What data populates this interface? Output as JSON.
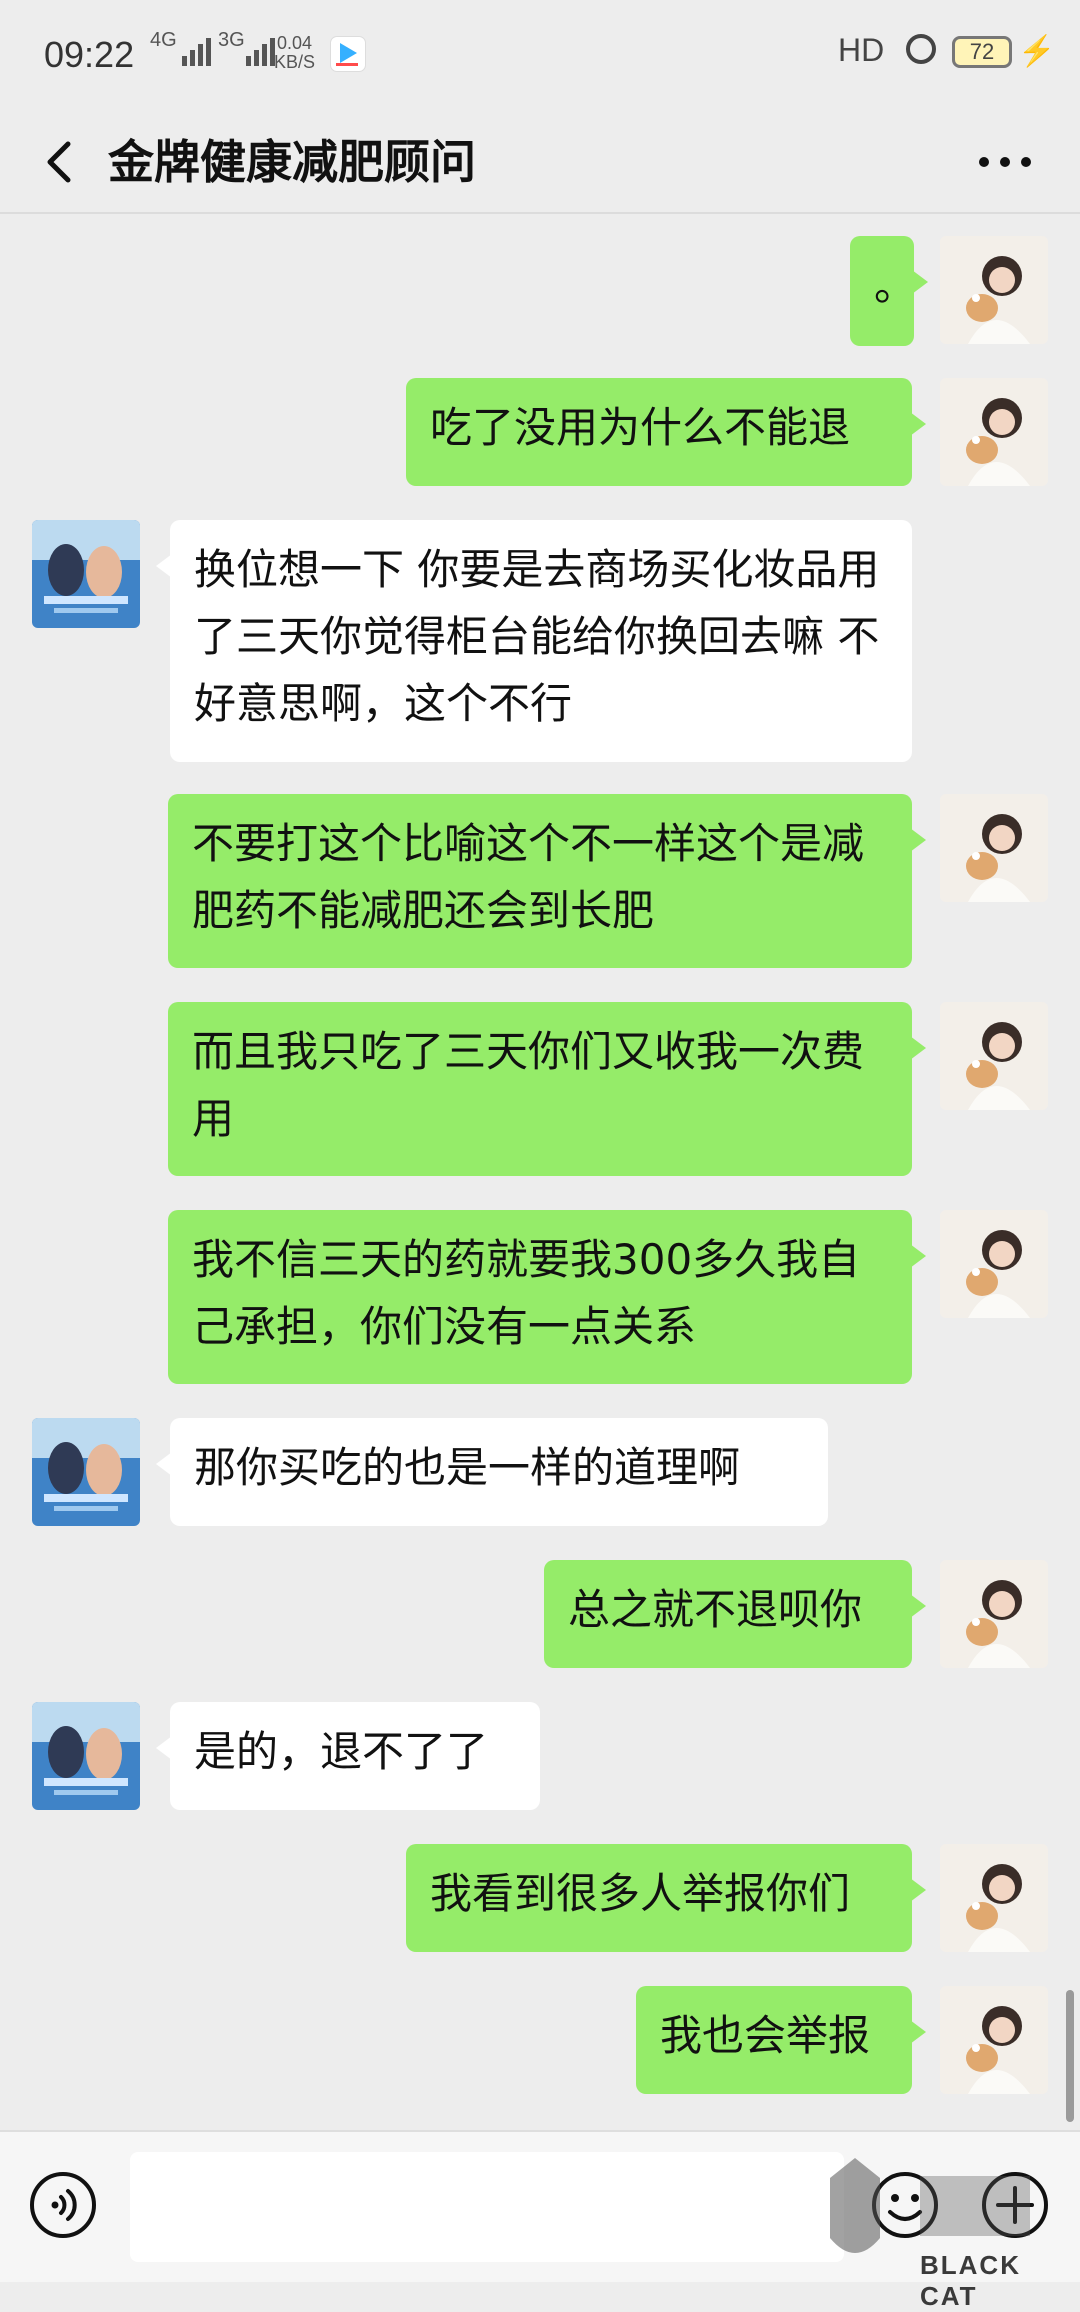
{
  "status_bar": {
    "time": "09:22",
    "net1": "4G",
    "net2": "3G",
    "speed_value": "0.04",
    "speed_unit": "KB/S",
    "hd": "HD",
    "battery": "72"
  },
  "header": {
    "title": "金牌健康减肥顾问"
  },
  "messages": [
    {
      "from": "self",
      "text": "。"
    },
    {
      "from": "self",
      "text": "吃了没用为什么不能退"
    },
    {
      "from": "other",
      "text": "换位想一下 你要是去商场买化妆品用了三天你觉得柜台能给你换回去嘛 不好意思啊，这个不行"
    },
    {
      "from": "self",
      "text": "不要打这个比喻这个不一样这个是减肥药不能减肥还会到长肥"
    },
    {
      "from": "self",
      "text": "而且我只吃了三天你们又收我一次费用"
    },
    {
      "from": "self",
      "text": "我不信三天的药就要我300多久我自己承担，你们没有一点关系"
    },
    {
      "from": "other",
      "text": "那你买吃的也是一样的道理啊"
    },
    {
      "from": "self",
      "text": "总之就不退呗你"
    },
    {
      "from": "other",
      "text": "是的，退不了了"
    },
    {
      "from": "self",
      "text": "我看到很多人举报你们"
    },
    {
      "from": "self",
      "text": "我也会举报"
    }
  ],
  "input_bar": {
    "placeholder": ""
  },
  "watermark": {
    "text": "BLACK CAT"
  },
  "colors": {
    "background": "#ededed",
    "self_bubble": "#95ec69",
    "other_bubble": "#ffffff"
  },
  "icons": [
    "back-icon",
    "more-icon",
    "voice-icon",
    "emoji-icon",
    "plus-icon"
  ]
}
